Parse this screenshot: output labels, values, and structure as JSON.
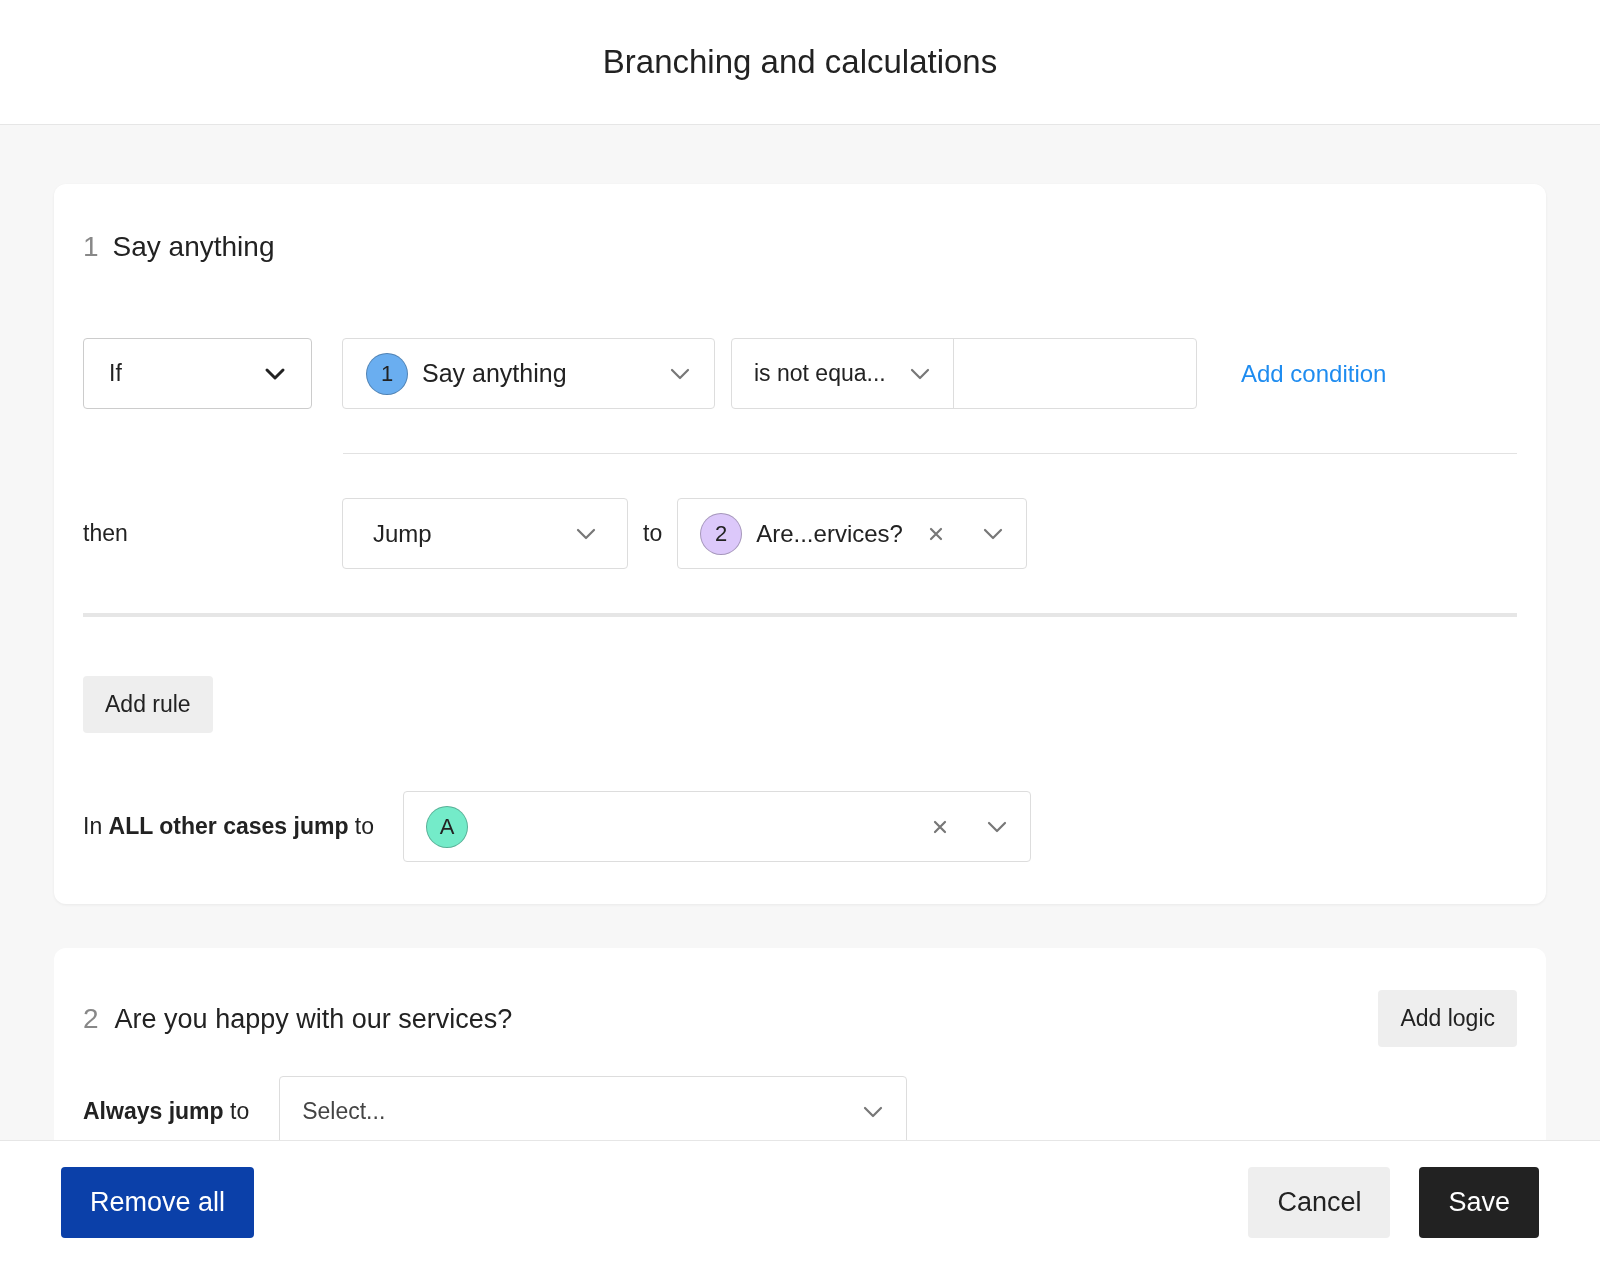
{
  "dialog": {
    "title": "Branching and calculations"
  },
  "blocks": [
    {
      "kind": "rules",
      "number": "1",
      "title": "Say anything",
      "rules": [
        {
          "connector": "If",
          "question": {
            "badge": "1",
            "color": "#6aaef0",
            "label": "Say anything"
          },
          "operator": "is not equa...",
          "add_condition": "Add condition",
          "then_label": "then",
          "action": "Jump",
          "to_label": "to",
          "target": {
            "badge": "2",
            "color": "#dcc8fa",
            "label": "Are...ervices?"
          }
        }
      ],
      "add_rule": "Add rule",
      "fallback": {
        "text": "In **ALL other cases jump** to",
        "target": {
          "badge": "A",
          "color": "#74ebc9"
        }
      }
    },
    {
      "kind": "simple",
      "number": "2",
      "title": "Are you happy with our services?",
      "add_logic": "Add logic",
      "always": {
        "text": "**Always jump** to",
        "placeholder": "Select..."
      }
    }
  ],
  "footer": {
    "remove_all": "Remove all",
    "cancel": "Cancel",
    "save": "Save"
  }
}
